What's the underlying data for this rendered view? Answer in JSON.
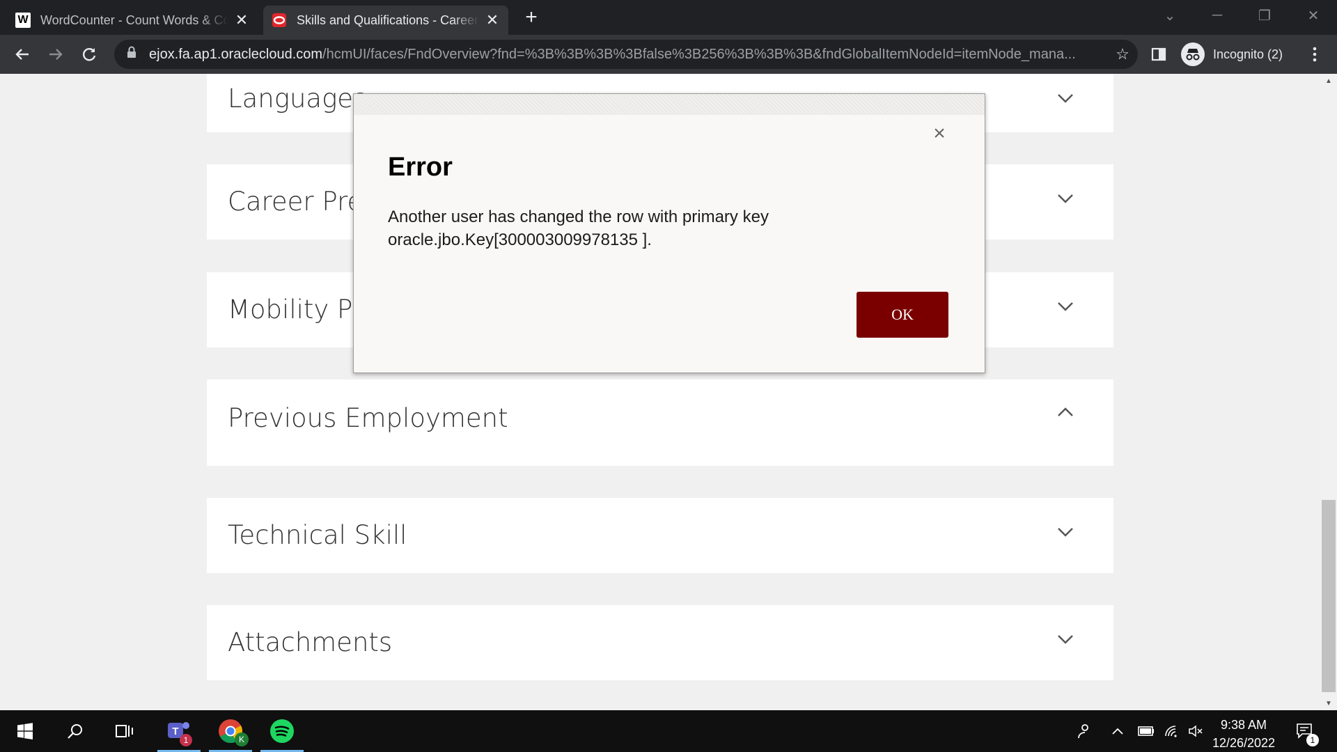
{
  "browser": {
    "tabs": [
      {
        "title": "WordCounter - Count Words & Correct Writing",
        "favicon": "W",
        "active": false
      },
      {
        "title": "Skills and Qualifications - Career and Performance",
        "favicon": "oracle-icon",
        "active": true
      }
    ],
    "url_host": "ejox.fa.ap1.oraclecloud.com",
    "url_rest": "/hcmUI/faces/FndOverview?fnd=%3B%3B%3B%3Bfalse%3B256%3B%3B%3B&fndGlobalItemNodeId=itemNode_mana...",
    "profile_label": "Incognito (2)"
  },
  "sections": [
    {
      "title": "Languages",
      "expanded": false
    },
    {
      "title": "Career Preferences",
      "expanded": false
    },
    {
      "title": "Mobility Preferences",
      "expanded": false
    },
    {
      "title": "Previous Employment",
      "expanded": true
    },
    {
      "title": "Technical Skill",
      "expanded": false
    },
    {
      "title": "Attachments",
      "expanded": false
    }
  ],
  "dialog": {
    "title": "Error",
    "message_line1": "Another user has changed the row with primary key",
    "message_line2": "oracle.jbo.Key[300003009978135 ].",
    "ok_label": "OK"
  },
  "taskbar": {
    "teams_badge": "1",
    "chrome_badge": "K",
    "time": "9:38 AM",
    "date": "12/26/2022",
    "notification_count": "1"
  },
  "colors": {
    "ok_button": "#7a0000",
    "page_bg": "#f1f0f0"
  }
}
